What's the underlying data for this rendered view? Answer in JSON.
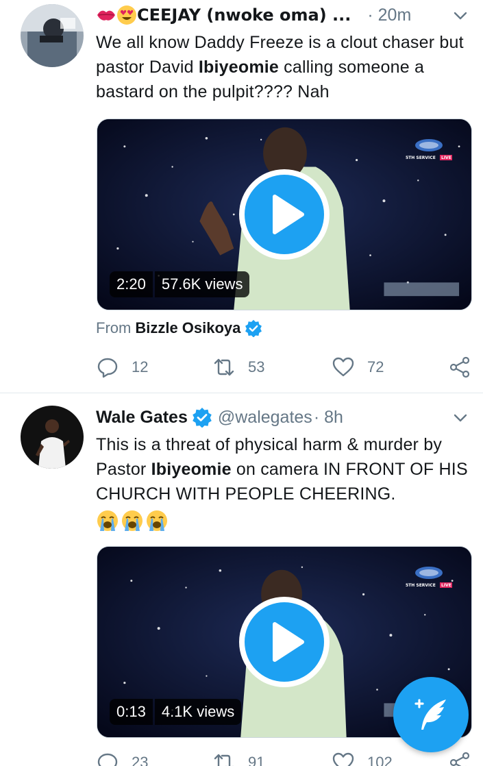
{
  "tweets": [
    {
      "display_name": "CEEJAY (nwoke oma) ...",
      "time": "· 20m",
      "text_parts": [
        "We all know Daddy Freeze is a clout chaser but pastor David ",
        "Ibiyeomie",
        " calling someone a bastard on the pulpit???? Nah"
      ],
      "video": {
        "duration": "2:20",
        "views": "57.6K views",
        "logo_text": "5TH SERVICE",
        "live_text": "LIVE"
      },
      "from_label": "From",
      "from_name": "Bizzle Osikoya",
      "replies": "12",
      "retweets": "53",
      "likes": "72"
    },
    {
      "display_name": "Wale Gates",
      "handle": "@walegates",
      "time": "· 8h",
      "text_parts": [
        "This is a threat of physical harm & murder by Pastor ",
        "Ibiyeomie",
        " on camera IN FRONT OF HIS CHURCH WITH PEOPLE CHEERING."
      ],
      "video": {
        "duration": "0:13",
        "views": "4.1K views",
        "logo_text": "5TH SERVICE",
        "live_text": "LIVE"
      },
      "replies": "23",
      "retweets": "91",
      "likes": "102"
    }
  ],
  "icons": {
    "reply": "reply-icon",
    "retweet": "retweet-icon",
    "like": "heart-icon",
    "share": "share-icon",
    "verified": "verified-badge-icon",
    "compose": "compose-tweet-icon",
    "more": "chevron-down-icon"
  },
  "colors": {
    "accent": "#1da1f2",
    "text": "#14171a",
    "secondary": "#657786",
    "divider": "#e1e8ed"
  }
}
